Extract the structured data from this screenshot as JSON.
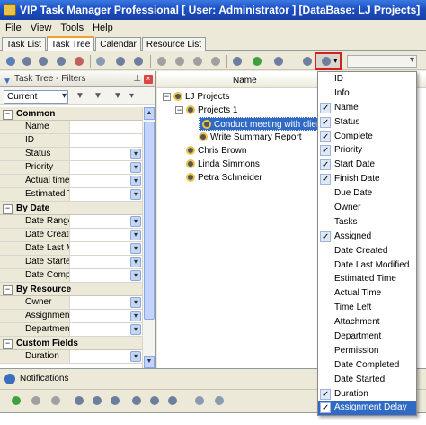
{
  "window": {
    "title": "VIP Task Manager Professional [ User: Administrator ] [DataBase: LJ Projects]"
  },
  "menu": [
    "File",
    "View",
    "Tools",
    "Help"
  ],
  "tabs": [
    "Task List",
    "Task Tree",
    "Calendar",
    "Resource List"
  ],
  "active_tab": "Task Tree",
  "filter_panel": {
    "title": "Task Tree - Filters",
    "preset": "Current",
    "groups": [
      {
        "label": "Common",
        "rows": [
          {
            "name": "Name",
            "dropdown": false
          },
          {
            "name": "ID",
            "dropdown": false
          },
          {
            "name": "Status",
            "dropdown": true
          },
          {
            "name": "Priority",
            "dropdown": true
          },
          {
            "name": "Actual time",
            "dropdown": true
          },
          {
            "name": "Estimated Ti",
            "dropdown": true
          }
        ]
      },
      {
        "label": "By Date",
        "rows": [
          {
            "name": "Date Range",
            "dropdown": true
          },
          {
            "name": "Date Create",
            "dropdown": true
          },
          {
            "name": "Date Last M",
            "dropdown": true
          },
          {
            "name": "Date Startec",
            "dropdown": true
          },
          {
            "name": "Date Compl",
            "dropdown": true
          }
        ]
      },
      {
        "label": "By Resource",
        "rows": [
          {
            "name": "Owner",
            "dropdown": true
          },
          {
            "name": "Assignment",
            "dropdown": true
          },
          {
            "name": "Department",
            "dropdown": true
          }
        ]
      },
      {
        "label": "Custom Fields",
        "rows": [
          {
            "name": "Duration",
            "dropdown": true
          }
        ]
      }
    ]
  },
  "tree": {
    "column": "Name",
    "nodes": [
      {
        "label": "LJ Projects",
        "level": 0
      },
      {
        "label": "Projects 1",
        "level": 1
      },
      {
        "label": "Conduct meeting with clients",
        "level": 2,
        "selected": true
      },
      {
        "label": "Write Summary Report",
        "level": 2
      },
      {
        "label": "Chris Brown",
        "level": 1
      },
      {
        "label": "Linda Simmons",
        "level": 1
      },
      {
        "label": "Petra Schneider",
        "level": 1
      }
    ]
  },
  "column_menu": {
    "items": [
      {
        "label": "ID",
        "checked": false
      },
      {
        "label": "Info",
        "checked": false
      },
      {
        "label": "Name",
        "checked": true
      },
      {
        "label": "Status",
        "checked": true
      },
      {
        "label": "Complete",
        "checked": true
      },
      {
        "label": "Priority",
        "checked": true
      },
      {
        "label": "Start Date",
        "checked": true
      },
      {
        "label": "Finish Date",
        "checked": true
      },
      {
        "label": "Due Date",
        "checked": false
      },
      {
        "label": "Owner",
        "checked": false
      },
      {
        "label": "Tasks",
        "checked": false
      },
      {
        "label": "Assigned",
        "checked": true
      },
      {
        "label": "Date Created",
        "checked": false
      },
      {
        "label": "Date Last Modified",
        "checked": false
      },
      {
        "label": "Estimated Time",
        "checked": false
      },
      {
        "label": "Actual Time",
        "checked": false
      },
      {
        "label": "Time Left",
        "checked": false
      },
      {
        "label": "Attachment",
        "checked": false
      },
      {
        "label": "Department",
        "checked": false
      },
      {
        "label": "Permission",
        "checked": false
      },
      {
        "label": "Date Completed",
        "checked": false
      },
      {
        "label": "Date Started",
        "checked": false
      },
      {
        "label": "Duration",
        "checked": true
      },
      {
        "label": "Assignment Delay",
        "checked": true,
        "highlighted": true
      }
    ]
  },
  "notifications": {
    "title": "Notifications"
  },
  "colors": {
    "title_bar": "#1c4fc4",
    "selection": "#316ac5",
    "highlight_border": "#d02020"
  }
}
